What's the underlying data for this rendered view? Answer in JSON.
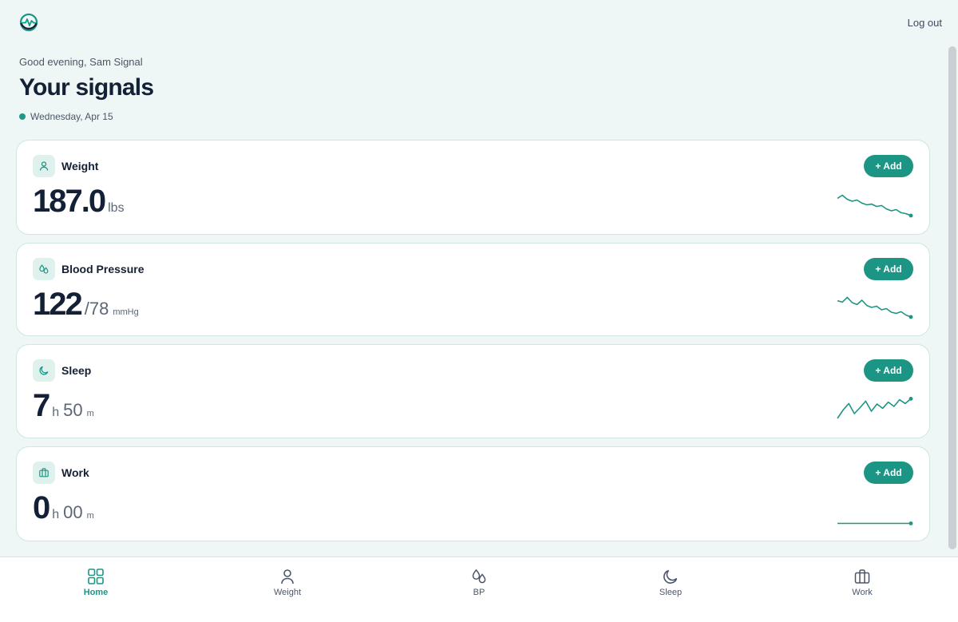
{
  "header": {
    "logo_icon": "pulse-logo-icon",
    "logout_label": "Log out"
  },
  "greeting": "Good evening, Sam Signal",
  "title": "Your signals",
  "date": "Wednesday, Apr 15",
  "colors": {
    "accent": "#1d9585",
    "background": "#eef7f5",
    "text": "#132036"
  },
  "cards": {
    "weight": {
      "icon": "person-icon",
      "title": "Weight",
      "add_label": "+ Add",
      "value": "187.0",
      "unit": "lbs"
    },
    "bp": {
      "icon": "drops-icon",
      "title": "Blood Pressure",
      "add_label": "+ Add",
      "systolic": "122",
      "diastolic": "/78",
      "unit": "mmHg"
    },
    "sleep": {
      "icon": "moon-icon",
      "title": "Sleep",
      "add_label": "+ Add",
      "hours": "7",
      "h_unit": "h",
      "minutes": "50",
      "m_unit": "m"
    },
    "work": {
      "icon": "briefcase-icon",
      "title": "Work",
      "add_label": "+ Add",
      "hours": "0",
      "h_unit": "h",
      "minutes": "00",
      "m_unit": "m"
    }
  },
  "sparklines": {
    "weight": [
      0.82,
      0.95,
      0.78,
      0.7,
      0.75,
      0.62,
      0.55,
      0.58,
      0.48,
      0.52,
      0.38,
      0.3,
      0.35,
      0.22,
      0.18,
      0.1
    ],
    "bp": [
      0.78,
      0.72,
      0.92,
      0.7,
      0.62,
      0.8,
      0.58,
      0.5,
      0.55,
      0.4,
      0.45,
      0.3,
      0.25,
      0.32,
      0.18,
      0.1
    ],
    "sleep": [
      0.1,
      0.45,
      0.72,
      0.3,
      0.55,
      0.82,
      0.4,
      0.7,
      0.52,
      0.78,
      0.6,
      0.88,
      0.72,
      0.92
    ],
    "work": [
      0.05,
      0.05,
      0.05,
      0.05,
      0.05,
      0.05,
      0.05,
      0.05
    ]
  },
  "nav": {
    "items": [
      {
        "label": "Home",
        "icon": "grid-icon",
        "active": true
      },
      {
        "label": "Weight",
        "icon": "person-icon",
        "active": false
      },
      {
        "label": "BP",
        "icon": "drops-icon",
        "active": false
      },
      {
        "label": "Sleep",
        "icon": "moon-icon",
        "active": false
      },
      {
        "label": "Work",
        "icon": "briefcase-icon",
        "active": false
      }
    ]
  }
}
